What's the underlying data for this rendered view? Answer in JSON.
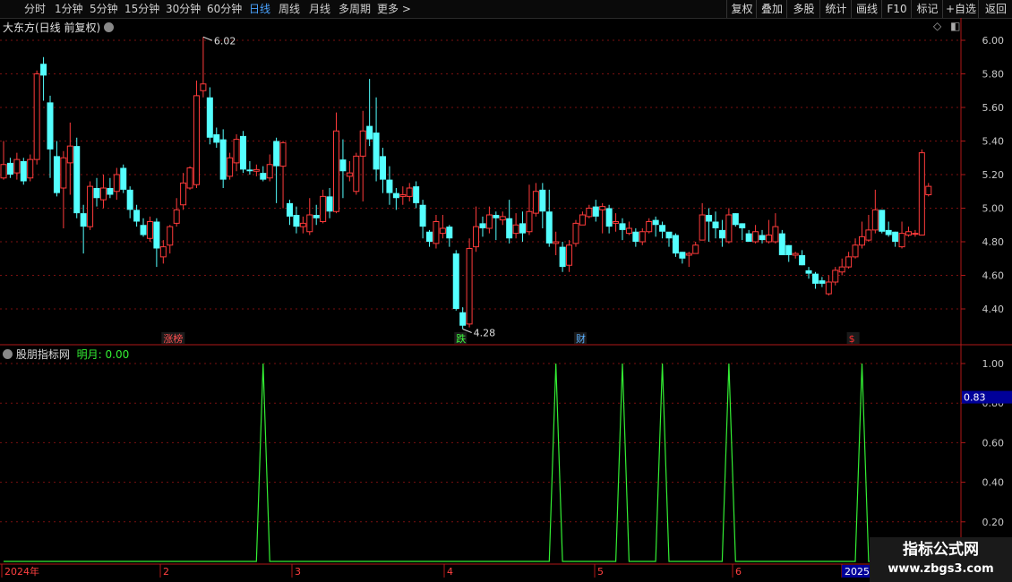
{
  "toolbar": {
    "periods": [
      "分时",
      "1分钟",
      "5分钟",
      "15分钟",
      "30分钟",
      "60分钟",
      "日线",
      "周线",
      "月线",
      "多周期",
      "更多 >"
    ],
    "active": "日线",
    "right_buttons": [
      "复权",
      "叠加",
      "多股",
      "统计",
      "画线",
      "F10",
      "标记",
      "+自选",
      "返回"
    ]
  },
  "main_title": "大东方(日线 前复权)",
  "indicator": {
    "name": "股朋指标网",
    "series_label": "明月: 0.00",
    "current_value_tag": "0.83"
  },
  "watermark": {
    "line1": "指标公式网",
    "line2": "www.zbgs3.com"
  },
  "colors": {
    "up": "#ff3b3b",
    "down": "#54ffff",
    "indicator": "#33ee33",
    "axis": "#b01818",
    "tag_bg": "#000099"
  },
  "icons": [
    "chevron-down-icon",
    "diamond-icon",
    "window-toggle-icon"
  ],
  "chart_data": [
    {
      "type": "candlestick",
      "title": "大东方(日线 前复权)",
      "ylim": [
        4.3,
        6.07
      ],
      "y_ticks": [
        "6.00",
        "5.80",
        "5.60",
        "5.40",
        "5.20",
        "5.00",
        "4.80",
        "4.60",
        "4.40"
      ],
      "x_labels": [
        "2024年",
        "2",
        "3",
        "4",
        "5",
        "6",
        "2025"
      ],
      "annotations": {
        "high": "6.02",
        "low": "4.28"
      },
      "markers": [
        {
          "label": "涨榜",
          "index": 24,
          "color": "#ff5050"
        },
        {
          "label": "跌",
          "index": 68,
          "color": "#40ff40"
        },
        {
          "label": "财",
          "index": 86,
          "color": "#5ab0ff"
        },
        {
          "label": "$",
          "index": 127,
          "color": "#ff3030"
        }
      ],
      "ohlc": [
        [
          5.18,
          5.26,
          5.4,
          5.17
        ],
        [
          5.27,
          5.2,
          5.3,
          5.18
        ],
        [
          5.21,
          5.29,
          5.33,
          5.17
        ],
        [
          5.28,
          5.16,
          5.3,
          5.14
        ],
        [
          5.18,
          5.29,
          5.32,
          5.16
        ],
        [
          5.29,
          5.8,
          5.82,
          5.26
        ],
        [
          5.86,
          5.79,
          5.9,
          5.64
        ],
        [
          5.63,
          5.35,
          5.67,
          5.18
        ],
        [
          5.31,
          5.09,
          5.4,
          5.07
        ],
        [
          5.12,
          5.3,
          5.34,
          4.88
        ],
        [
          5.27,
          5.37,
          5.51,
          5.08
        ],
        [
          5.37,
          4.97,
          5.42,
          4.94
        ],
        [
          4.97,
          4.89,
          5.02,
          4.73
        ],
        [
          4.89,
          5.13,
          5.16,
          4.87
        ],
        [
          5.12,
          5.06,
          5.18,
          5.01
        ],
        [
          5.05,
          5.12,
          5.2,
          5.0
        ],
        [
          5.12,
          5.08,
          5.18,
          5.06
        ],
        [
          5.1,
          5.2,
          5.24,
          5.05
        ],
        [
          5.24,
          5.11,
          5.26,
          5.09
        ],
        [
          5.11,
          4.99,
          5.13,
          4.94
        ],
        [
          4.99,
          4.92,
          5.02,
          4.89
        ],
        [
          4.9,
          4.84,
          4.94,
          4.83
        ],
        [
          4.82,
          4.92,
          4.95,
          4.8
        ],
        [
          4.92,
          4.76,
          4.94,
          4.65
        ],
        [
          4.71,
          4.77,
          4.81,
          4.67
        ],
        [
          4.78,
          4.89,
          4.9,
          4.73
        ],
        [
          4.91,
          4.99,
          5.06,
          4.89
        ],
        [
          5.02,
          5.15,
          5.21,
          4.99
        ],
        [
          5.12,
          5.24,
          5.25,
          5.11
        ],
        [
          5.14,
          5.67,
          5.76,
          5.12
        ],
        [
          5.7,
          5.74,
          6.02,
          5.66
        ],
        [
          5.66,
          5.42,
          5.72,
          5.38
        ],
        [
          5.44,
          5.39,
          5.48,
          5.36
        ],
        [
          5.41,
          5.17,
          5.47,
          5.12
        ],
        [
          5.19,
          5.3,
          5.33,
          5.17
        ],
        [
          5.27,
          5.41,
          5.44,
          5.22
        ],
        [
          5.43,
          5.23,
          5.46,
          5.21
        ],
        [
          5.23,
          5.22,
          5.28,
          5.2
        ],
        [
          5.22,
          5.23,
          5.26,
          5.19
        ],
        [
          5.21,
          5.17,
          5.25,
          5.16
        ],
        [
          5.18,
          5.26,
          5.32,
          5.16
        ],
        [
          5.4,
          5.25,
          5.42,
          5.03
        ],
        [
          5.25,
          5.39,
          5.4,
          5.0
        ],
        [
          5.03,
          4.95,
          5.05,
          4.9
        ],
        [
          4.96,
          4.89,
          5.01,
          4.85
        ],
        [
          4.89,
          4.91,
          4.95,
          4.85
        ],
        [
          4.86,
          4.96,
          5.06,
          4.84
        ],
        [
          4.96,
          4.94,
          5.02,
          4.9
        ],
        [
          4.92,
          5.07,
          5.11,
          4.91
        ],
        [
          5.07,
          4.98,
          5.12,
          4.94
        ],
        [
          4.98,
          5.46,
          5.57,
          4.97
        ],
        [
          5.29,
          5.22,
          5.41,
          5.06
        ],
        [
          5.19,
          5.21,
          5.28,
          5.16
        ],
        [
          5.1,
          5.31,
          5.33,
          5.08
        ],
        [
          5.31,
          5.46,
          5.58,
          5.04
        ],
        [
          5.49,
          5.41,
          5.77,
          5.37
        ],
        [
          5.45,
          5.23,
          5.66,
          5.16
        ],
        [
          5.31,
          5.17,
          5.36,
          5.09
        ],
        [
          5.17,
          5.09,
          5.25,
          5.02
        ],
        [
          5.09,
          5.06,
          5.12,
          4.99
        ],
        [
          5.07,
          5.08,
          5.13,
          5.02
        ],
        [
          5.07,
          5.12,
          5.15,
          5.04
        ],
        [
          5.13,
          5.03,
          5.16,
          5.0
        ],
        [
          5.02,
          4.89,
          5.05,
          4.82
        ],
        [
          4.86,
          4.8,
          4.87,
          4.77
        ],
        [
          4.79,
          4.92,
          4.96,
          4.76
        ],
        [
          4.85,
          4.88,
          4.96,
          4.82
        ],
        [
          4.89,
          4.82,
          4.9,
          4.77
        ],
        [
          4.73,
          4.4,
          4.75,
          4.39
        ],
        [
          4.38,
          4.3,
          4.41,
          4.28
        ],
        [
          4.31,
          4.76,
          4.82,
          4.29
        ],
        [
          4.77,
          4.89,
          5.01,
          4.74
        ],
        [
          4.91,
          4.88,
          4.95,
          4.83
        ],
        [
          4.88,
          4.96,
          5.01,
          4.85
        ],
        [
          4.96,
          4.94,
          4.98,
          4.81
        ],
        [
          4.93,
          4.95,
          4.98,
          4.9
        ],
        [
          4.94,
          4.82,
          5.05,
          4.79
        ],
        [
          4.85,
          4.9,
          4.97,
          4.82
        ],
        [
          4.91,
          4.85,
          4.98,
          4.8
        ],
        [
          4.86,
          4.98,
          5.14,
          4.84
        ],
        [
          4.97,
          5.1,
          5.15,
          4.95
        ],
        [
          5.11,
          4.98,
          5.15,
          4.88
        ],
        [
          4.98,
          4.79,
          5.11,
          4.77
        ],
        [
          4.79,
          4.8,
          4.86,
          4.72
        ],
        [
          4.77,
          4.65,
          4.8,
          4.62
        ],
        [
          4.66,
          4.78,
          4.81,
          4.62
        ],
        [
          4.79,
          4.91,
          4.93,
          4.77
        ],
        [
          4.9,
          4.96,
          4.98,
          4.9
        ],
        [
          4.95,
          5.0,
          5.02,
          4.94
        ],
        [
          5.01,
          4.95,
          5.05,
          4.92
        ],
        [
          4.99,
          5.01,
          5.03,
          4.85
        ],
        [
          5.0,
          4.89,
          5.02,
          4.85
        ],
        [
          4.91,
          4.92,
          4.97,
          4.86
        ],
        [
          4.91,
          4.87,
          4.94,
          4.81
        ],
        [
          4.85,
          4.88,
          4.92,
          4.84
        ],
        [
          4.86,
          4.8,
          4.88,
          4.77
        ],
        [
          4.8,
          4.86,
          4.88,
          4.78
        ],
        [
          4.86,
          4.92,
          4.94,
          4.85
        ],
        [
          4.93,
          4.9,
          4.95,
          4.83
        ],
        [
          4.9,
          4.86,
          4.92,
          4.82
        ],
        [
          4.86,
          4.82,
          4.85,
          4.77
        ],
        [
          4.84,
          4.73,
          4.85,
          4.71
        ],
        [
          4.74,
          4.7,
          4.74,
          4.67
        ],
        [
          4.72,
          4.73,
          4.74,
          4.65
        ],
        [
          4.73,
          4.78,
          4.8,
          4.73
        ],
        [
          4.81,
          4.96,
          5.03,
          4.81
        ],
        [
          4.96,
          4.92,
          5.0,
          4.8
        ],
        [
          4.92,
          4.88,
          4.98,
          4.82
        ],
        [
          4.87,
          4.82,
          4.93,
          4.77
        ],
        [
          4.8,
          4.96,
          5.0,
          4.79
        ],
        [
          4.97,
          4.9,
          4.97,
          4.89
        ],
        [
          4.91,
          4.88,
          4.91,
          4.81
        ],
        [
          4.85,
          4.8,
          4.87,
          4.81
        ],
        [
          4.8,
          4.86,
          4.9,
          4.79
        ],
        [
          4.84,
          4.81,
          4.87,
          4.79
        ],
        [
          4.8,
          4.84,
          4.93,
          4.79
        ],
        [
          4.8,
          4.89,
          4.97,
          4.79
        ],
        [
          4.85,
          4.72,
          4.87,
          4.72
        ],
        [
          4.78,
          4.72,
          4.78,
          4.68
        ],
        [
          4.72,
          4.73,
          4.74,
          4.7
        ],
        [
          4.72,
          4.66,
          4.75,
          4.66
        ],
        [
          4.63,
          4.61,
          4.65,
          4.58
        ],
        [
          4.61,
          4.55,
          4.62,
          4.52
        ],
        [
          4.57,
          4.55,
          4.59,
          4.53
        ],
        [
          4.49,
          4.56,
          4.6,
          4.48
        ],
        [
          4.56,
          4.63,
          4.65,
          4.54
        ],
        [
          4.62,
          4.65,
          4.7,
          4.6
        ],
        [
          4.65,
          4.71,
          4.74,
          4.64
        ],
        [
          4.71,
          4.78,
          4.82,
          4.7
        ],
        [
          4.78,
          4.83,
          4.92,
          4.76
        ],
        [
          4.81,
          4.87,
          4.96,
          4.8
        ],
        [
          4.87,
          4.99,
          5.11,
          4.85
        ],
        [
          4.99,
          4.86,
          4.99,
          4.85
        ],
        [
          4.87,
          4.84,
          4.92,
          4.83
        ],
        [
          4.86,
          4.8,
          4.86,
          4.77
        ],
        [
          4.77,
          4.85,
          4.92,
          4.76
        ],
        [
          4.84,
          4.86,
          4.89,
          4.83
        ],
        [
          4.85,
          4.85,
          4.87,
          4.83
        ],
        [
          4.84,
          5.33,
          5.35,
          4.84
        ],
        [
          5.08,
          5.13,
          5.15,
          5.07
        ]
      ]
    },
    {
      "type": "line",
      "name": "明月",
      "ylim": [
        0,
        1.05
      ],
      "y_ticks": [
        "1.00",
        "0.80",
        "0.60",
        "0.40",
        "0.20"
      ],
      "x_count": 140,
      "baseline": 0,
      "spike_indices": [
        39,
        83,
        93,
        99,
        109,
        129
      ],
      "spike_value": 1.0
    }
  ]
}
